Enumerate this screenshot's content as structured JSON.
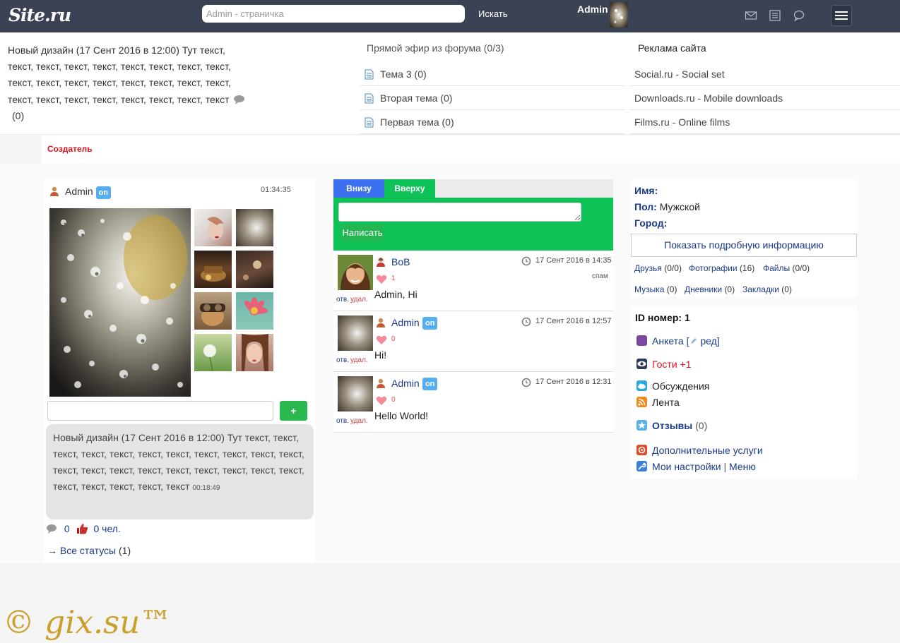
{
  "header": {
    "logo": "Site.ru",
    "search_placeholder": "Admin - страничка",
    "search_button": "Искать",
    "user_name": "Admin",
    "icons": [
      "mail-icon",
      "news-icon",
      "chat-icon",
      "menu-icon"
    ]
  },
  "news": {
    "title_line": "Новый дизайн (17 Сент 2016 в 12:00)",
    "body": "Тут текст, текст, текст, текст, текст, текст, текст, текст, текст, текст, текст, текст, текст, текст, текст, текст, текст, текст, текст, текст, текст, текст, текст, текст, текст",
    "comments": "(0)"
  },
  "forum": {
    "heading": "Прямой эфир из форума (0/3)",
    "items": [
      "Тема 3 (0)",
      "Вторая тема (0)",
      "Первая тема (0)"
    ]
  },
  "ads": {
    "heading": "Реклама сайта",
    "items": [
      "Social.ru - Social set",
      "Downloads.ru - Mobile downloads",
      "Films.ru - Online films"
    ]
  },
  "creator_label": "Создатель",
  "status": {
    "user": "Admin",
    "online": "on",
    "time": "01:34:35",
    "add_button": "+",
    "bubble_text": "Новый дизайн (17 Сент 2016 в 12:00) Тут текст, текст, текст, текст, текст, текст, текст, текст, текст, текст, текст, текст, текст, текст, текст, текст, текст, текст, текст, текст, текст, текст, текст, текст, текст",
    "bubble_time": "00:18:49",
    "comments_count": "0",
    "likes": "0 чел.",
    "all_statuses_arrow": "→",
    "all_statuses_link": "Все статусы",
    "all_statuses_count": "(1)"
  },
  "chat": {
    "tabs": [
      "Внизу",
      "Вверху"
    ],
    "submit": "Написать",
    "messages": [
      {
        "name": "BoB",
        "online": "",
        "time": "17 Сент 2016 в 14:35",
        "likes": "1",
        "spam": "спам",
        "text": "Admin, Hi",
        "reply": "отв.",
        "delete": "удал."
      },
      {
        "name": "Admin",
        "online": "on",
        "time": "17 Сент 2016 в 12:57",
        "likes": "0",
        "spam": "",
        "text": "Hi!",
        "reply": "отв.",
        "delete": "удал."
      },
      {
        "name": "Admin",
        "online": "on",
        "time": "17 Сент 2016 в 12:31",
        "likes": "0",
        "spam": "",
        "text": "Hello World!",
        "reply": "отв.",
        "delete": "удал."
      }
    ]
  },
  "profile": {
    "name_label": "Имя:",
    "gender_label": "Пол:",
    "gender_value": "Мужской",
    "city_label": "Город:",
    "show_more": "Показать подробную информацию",
    "links": {
      "friends": "Друзья",
      "friends_count": "(0/0)",
      "photos": "Фотографии",
      "photos_count": "(16)",
      "files": "Файлы",
      "files_count": "(0/0)",
      "music": "Музыка",
      "music_count": "(0)",
      "diaries": "Дневники",
      "diaries_count": "(0)",
      "bookmarks": "Закладки",
      "bookmarks_count": "(0)"
    }
  },
  "menu": {
    "id_label": "ID номер:",
    "id_value": "1",
    "anketa": "Анкета",
    "edit": "ред",
    "guests": "Гости +1",
    "discussions": "Обсуждения",
    "feed": "Лента",
    "reviews": "Отзывы",
    "reviews_count": "(0)",
    "services": "Дополнительные услуги",
    "settings": "Мои настройки",
    "separator": "|",
    "menu_link": "Меню"
  },
  "watermark": "© gix.su™",
  "colors": {
    "topbar": "#3a4254",
    "accent_green": "#0ec258",
    "tab_blue": "#3c70f0",
    "link": "#1a3a8a",
    "creator_red": "#e0101a"
  }
}
